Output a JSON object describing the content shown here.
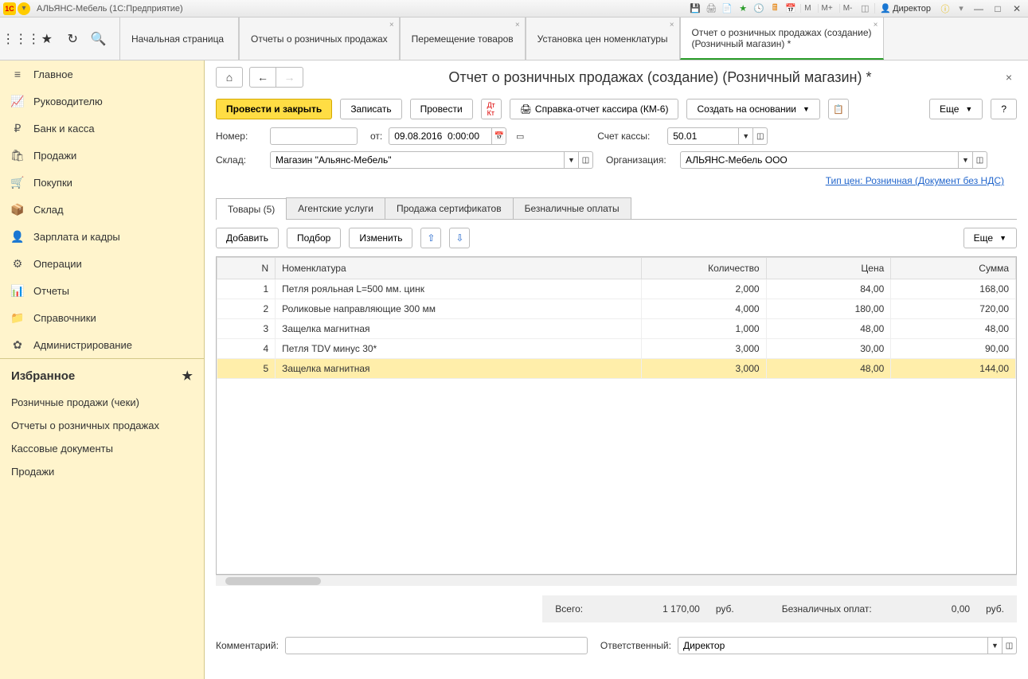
{
  "titlebar": {
    "app_name": "АЛЬЯНС-Мебель  (1С:Предприятие)",
    "mem_buttons": [
      "M",
      "M+",
      "M-"
    ],
    "user": "Директор"
  },
  "tabs": [
    {
      "label": "Начальная страница",
      "closable": false
    },
    {
      "label": "Отчеты о розничных продажах",
      "closable": true
    },
    {
      "label": "Перемещение товаров",
      "closable": true
    },
    {
      "label": "Установка цен номенклатуры",
      "closable": true
    },
    {
      "label": "Отчет о розничных продажах (создание) (Розничный магазин) *",
      "closable": true,
      "active": true
    }
  ],
  "sidebar": {
    "items": [
      {
        "icon": "≡",
        "label": "Главное"
      },
      {
        "icon": "📈",
        "label": "Руководителю"
      },
      {
        "icon": "₽",
        "label": "Банк и касса"
      },
      {
        "icon": "🛍",
        "label": "Продажи"
      },
      {
        "icon": "🛒",
        "label": "Покупки"
      },
      {
        "icon": "📦",
        "label": "Склад"
      },
      {
        "icon": "👤",
        "label": "Зарплата и кадры"
      },
      {
        "icon": "⚙",
        "label": "Операции"
      },
      {
        "icon": "📊",
        "label": "Отчеты"
      },
      {
        "icon": "📁",
        "label": "Справочники"
      },
      {
        "icon": "✿",
        "label": "Администрирование"
      }
    ],
    "favorites_title": "Избранное",
    "favorites": [
      "Розничные продажи (чеки)",
      "Отчеты о розничных продажах",
      "Кассовые документы",
      "Продажи"
    ]
  },
  "page": {
    "title": "Отчет о розничных продажах (создание) (Розничный магазин) *",
    "actions": {
      "post_close": "Провести и закрыть",
      "save": "Записать",
      "post": "Провести",
      "km6": "Справка-отчет кассира (КМ-6)",
      "create_based": "Создать на основании",
      "more": "Еще",
      "help": "?"
    },
    "form": {
      "number_label": "Номер:",
      "number": "",
      "date_label": "от:",
      "date": "09.08.2016  0:00:00",
      "account_label": "Счет кассы:",
      "account": "50.01",
      "warehouse_label": "Склад:",
      "warehouse": "Магазин \"Альянс-Мебель\"",
      "org_label": "Организация:",
      "org": "АЛЬЯНС-Мебель ООО",
      "price_type_link": "Тип цен: Розничная (Документ без НДС)"
    },
    "sub_tabs": [
      {
        "label": "Товары (5)",
        "active": true
      },
      {
        "label": "Агентские услуги"
      },
      {
        "label": "Продажа сертификатов"
      },
      {
        "label": "Безналичные оплаты"
      }
    ],
    "table_actions": {
      "add": "Добавить",
      "pick": "Подбор",
      "edit": "Изменить",
      "more": "Еще"
    },
    "table": {
      "headers": {
        "n": "N",
        "nom": "Номенклатура",
        "qty": "Количество",
        "price": "Цена",
        "sum": "Сумма"
      },
      "rows": [
        {
          "n": "1",
          "nom": "Петля рояльная L=500 мм. цинк",
          "qty": "2,000",
          "price": "84,00",
          "sum": "168,00"
        },
        {
          "n": "2",
          "nom": "Роликовые направляющие 300 мм",
          "qty": "4,000",
          "price": "180,00",
          "sum": "720,00"
        },
        {
          "n": "3",
          "nom": "Защелка магнитная",
          "qty": "1,000",
          "price": "48,00",
          "sum": "48,00"
        },
        {
          "n": "4",
          "nom": "Петля TDV минус 30*",
          "qty": "3,000",
          "price": "30,00",
          "sum": "90,00"
        },
        {
          "n": "5",
          "nom": "Защелка магнитная",
          "qty": "3,000",
          "price": "48,00",
          "sum": "144,00",
          "selected": true
        }
      ]
    },
    "totals": {
      "total_label": "Всего:",
      "total_value": "1 170,00",
      "total_cur": "руб.",
      "noncash_label": "Безналичных оплат:",
      "noncash_value": "0,00",
      "noncash_cur": "руб."
    },
    "footer": {
      "comment_label": "Комментарий:",
      "comment": "",
      "responsible_label": "Ответственный:",
      "responsible": "Директор"
    }
  }
}
